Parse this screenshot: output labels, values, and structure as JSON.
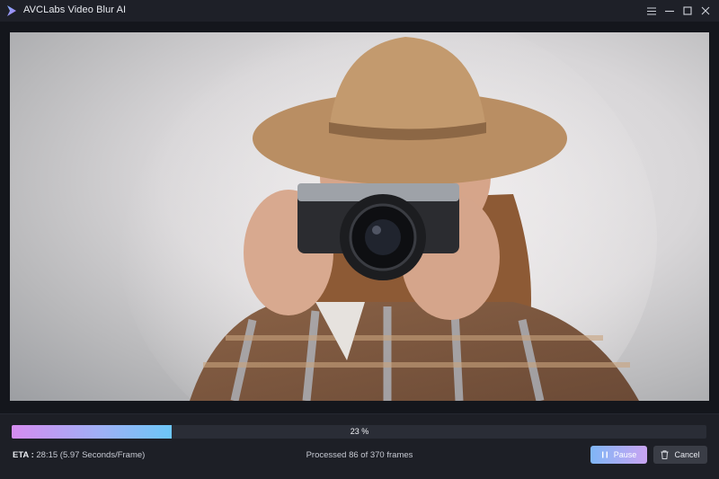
{
  "window": {
    "title": "AVCLabs Video Blur AI",
    "controls": [
      "menu-icon",
      "minimize-icon",
      "maximize-icon",
      "close-icon"
    ]
  },
  "preview": {
    "image_desc_icon": "photo-preview"
  },
  "progress": {
    "percent": 23,
    "label": "23 %"
  },
  "status": {
    "eta_label": "ETA :",
    "eta_value": "28:15 (5.97 Seconds/Frame)",
    "processed_text": "Processed 86 of 370 frames"
  },
  "buttons": {
    "pause_label": "Pause",
    "pause_icon": "pause-icon",
    "cancel_label": "Cancel",
    "cancel_icon": "trash-icon"
  },
  "colors": {
    "accent_start": "#d58cf0",
    "accent_end": "#6cc6f7",
    "background": "#1b1d24"
  }
}
